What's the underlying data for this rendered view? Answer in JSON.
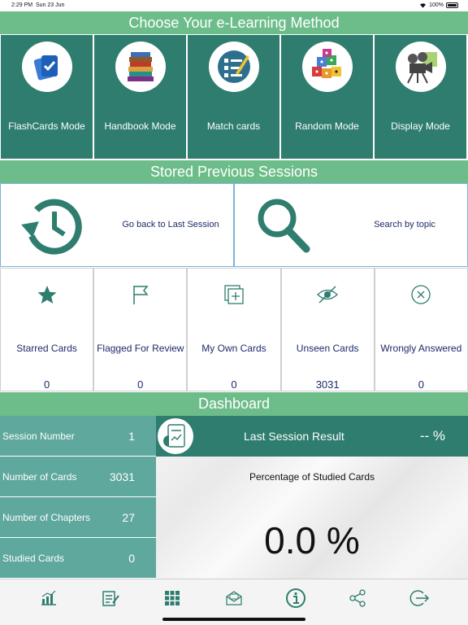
{
  "status_bar": {
    "time": "2:29 PM",
    "date": "Sun 23 Jun",
    "battery": "100%"
  },
  "sections": {
    "method": "Choose Your e-Learning Method",
    "stored": "Stored Previous Sessions",
    "dashboard": "Dashboard"
  },
  "modes": [
    {
      "label": "FlashCards Mode",
      "icon": "flashcards-icon"
    },
    {
      "label": "Handbook Mode",
      "icon": "books-icon"
    },
    {
      "label": "Match cards",
      "icon": "checklist-icon"
    },
    {
      "label": "Random Mode",
      "icon": "dice-icon"
    },
    {
      "label": "Display Mode",
      "icon": "projector-icon"
    }
  ],
  "stored": [
    {
      "label": "Go back to Last Session",
      "icon": "history-icon"
    },
    {
      "label": "Search by topic",
      "icon": "search-icon"
    }
  ],
  "categories": [
    {
      "label": "Starred Cards",
      "count": "0",
      "icon": "star-icon"
    },
    {
      "label": "Flagged For Review",
      "count": "0",
      "icon": "flag-icon"
    },
    {
      "label": "My Own Cards",
      "count": "0",
      "icon": "add-card-icon"
    },
    {
      "label": "Unseen Cards",
      "count": "3031",
      "icon": "eye-off-icon"
    },
    {
      "label": "Wrongly Answered",
      "count": "0",
      "icon": "x-circle-icon"
    }
  ],
  "stats": [
    {
      "label": "Session Number",
      "value": "1"
    },
    {
      "label": "Number of Cards",
      "value": "3031"
    },
    {
      "label": "Number of Chapters",
      "value": "27"
    },
    {
      "label": "Studied Cards",
      "value": "0"
    }
  ],
  "result": {
    "title": "Last Session Result",
    "value": "-- %",
    "studied_label": "Percentage of Studied Cards",
    "studied_value": "0.0 %"
  },
  "tabs": [
    "stats-icon",
    "checklist-edit-icon",
    "grid-icon",
    "mail-icon",
    "info-icon",
    "share-icon",
    "logout-icon"
  ],
  "colors": {
    "header": "#6dbd8a",
    "tile": "#2e7d6e",
    "stat": "#5fa89d",
    "text": "#1f2a6b"
  }
}
